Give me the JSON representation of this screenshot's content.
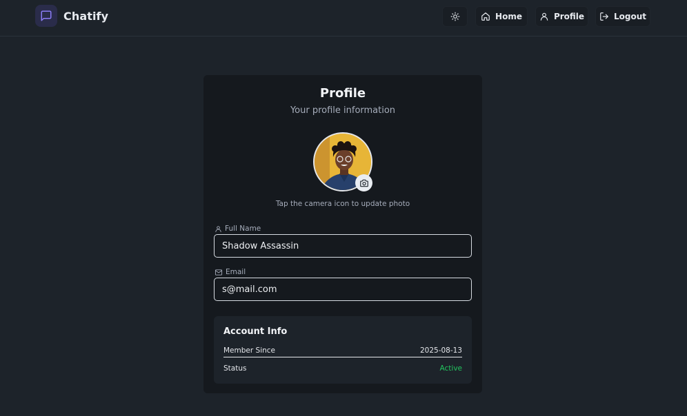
{
  "app": {
    "brand_name": "Chatify"
  },
  "nav": {
    "theme_icon": "sun-icon",
    "home_label": "Home",
    "home_icon": "home-icon",
    "profile_label": "Profile",
    "profile_icon": "user-icon",
    "logout_label": "Logout",
    "logout_icon": "logout-icon"
  },
  "profile": {
    "title": "Profile",
    "subtitle": "Your profile information",
    "photo_hint": "Tap the camera icon to update photo",
    "camera_icon": "camera-icon"
  },
  "fields": {
    "name_label": "Full Name",
    "name_value": "Shadow Assassin",
    "email_label": "Email",
    "email_value": "s@mail.com"
  },
  "account": {
    "title": "Account Info",
    "member_since_label": "Member Since",
    "member_since_value": "2025-08-13",
    "status_label": "Status",
    "status_value": "Active"
  },
  "colors": {
    "background": "#1d232a",
    "card": "#15191e",
    "accent": "#6d5ce8",
    "status_active": "#22c55e"
  }
}
